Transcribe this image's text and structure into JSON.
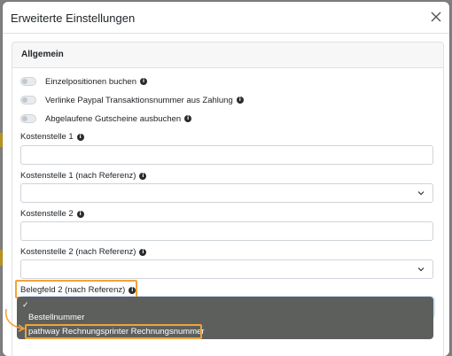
{
  "dialog": {
    "title": "Erweiterte Einstellungen"
  },
  "section": {
    "title": "Allgemein"
  },
  "toggles": [
    {
      "label": "Einzelpositionen buchen",
      "checked": false
    },
    {
      "label": "Verlinke Paypal Transaktionsnummer aus Zahlung",
      "checked": false
    },
    {
      "label": "Abgelaufene Gutscheine ausbuchen",
      "checked": false
    }
  ],
  "fields": {
    "kostenstelle1": {
      "label": "Kostenstelle 1",
      "value": ""
    },
    "kostenstelle1_ref": {
      "label": "Kostenstelle 1 (nach Referenz)",
      "value": ""
    },
    "kostenstelle2": {
      "label": "Kostenstelle 2",
      "value": ""
    },
    "kostenstelle2_ref": {
      "label": "Kostenstelle 2 (nach Referenz)",
      "value": ""
    },
    "belegfeld2_ref": {
      "label": "Belegfeld 2 (nach Referenz)"
    }
  },
  "dropdown": {
    "selected_mark": "✓",
    "options": [
      "Bestellnummer",
      "pathway Rechnungsprinter Rechnungsnummer"
    ]
  },
  "icons": {
    "info": "info-icon",
    "close": "close-icon",
    "chevron": "chevron-down-icon",
    "arrow": "annotation-arrow"
  },
  "colors": {
    "highlight": "#f0a33a",
    "dropdown_bg": "#5d5f5d",
    "backdrop": "#7f7f7f"
  }
}
